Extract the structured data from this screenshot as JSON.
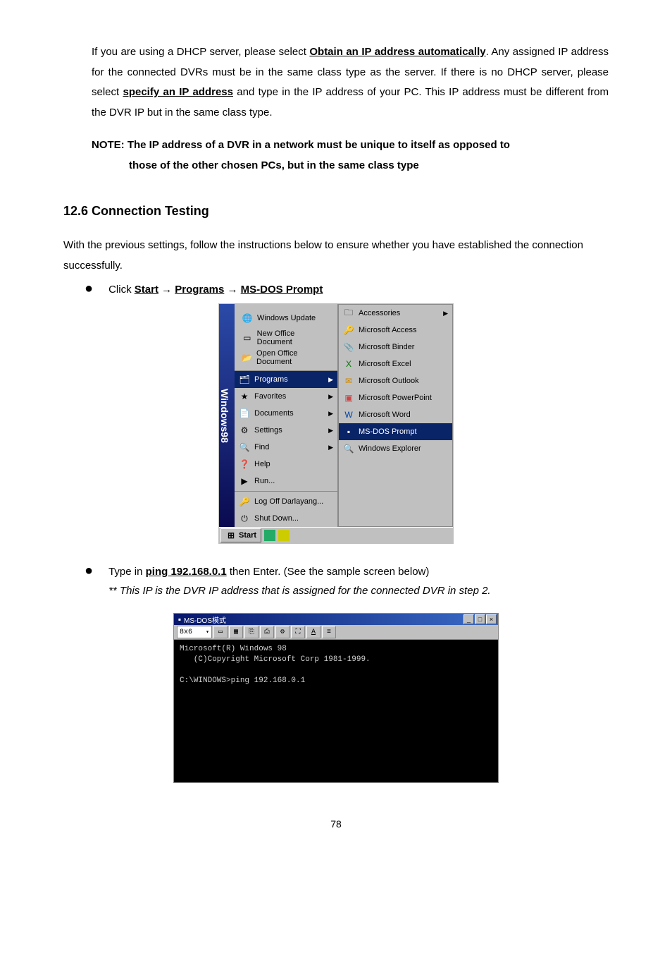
{
  "para1": {
    "t1": "If you are using a DHCP server, please select ",
    "u1": "Obtain an IP address automatically",
    "t2": ". Any assigned IP address for the connected DVRs must be in the same class type as the server. If there is no DHCP server, please select ",
    "u2": "specify an IP address",
    "t3": " and type in the IP address of your PC. This IP address must be different from the DVR IP but in the same class type."
  },
  "note": {
    "line1": "NOTE: The IP address of a DVR in a network must be unique to itself as opposed to",
    "line2": "those of the other chosen PCs, but in the same class type"
  },
  "section_heading": "12.6 Connection Testing",
  "para2": "With the previous settings, follow the instructions below to ensure whether you have established the connection successfully.",
  "bullet1": {
    "pre": "Click ",
    "start": "Start",
    "arrow1": " → ",
    "programs": "Programs",
    "arrow2": " → ",
    "msdos": "MS-DOS Prompt"
  },
  "startmenu": {
    "stripe": "Windows98",
    "top": {
      "win_update": "Windows Update",
      "new_doc": "New Office Document",
      "open_doc": "Open Office Document"
    },
    "items": {
      "programs": "Programs",
      "favorites": "Favorites",
      "documents": "Documents",
      "settings": "Settings",
      "find": "Find",
      "help": "Help",
      "run": "Run...",
      "logoff": "Log Off Darlayang...",
      "shutdown": "Shut Down..."
    },
    "submenu": {
      "accessories": "Accessories",
      "access": "Microsoft Access",
      "binder": "Microsoft Binder",
      "excel": "Microsoft Excel",
      "outlook": "Microsoft Outlook",
      "powerpoint": "Microsoft PowerPoint",
      "word": "Microsoft Word",
      "msdos": "MS-DOS Prompt",
      "explorer": "Windows Explorer"
    },
    "taskbar": {
      "start": "Start"
    }
  },
  "bullet2": {
    "t1": "Type in ",
    "cmd": "ping 192.168.0.1",
    "t2": " then Enter. (See the sample screen below)",
    "note": "** This IP is the DVR IP address that is assigned for the connected DVR in step 2."
  },
  "dos": {
    "title": "MS-DOS模式",
    "toolbar_selected": "8x6",
    "line1": "Microsoft(R) Windows 98",
    "line2": "   (C)Copyright Microsoft Corp 1981-1999.",
    "line3": "C:\\WINDOWS>ping 192.168.0.1"
  },
  "page_number": "78"
}
